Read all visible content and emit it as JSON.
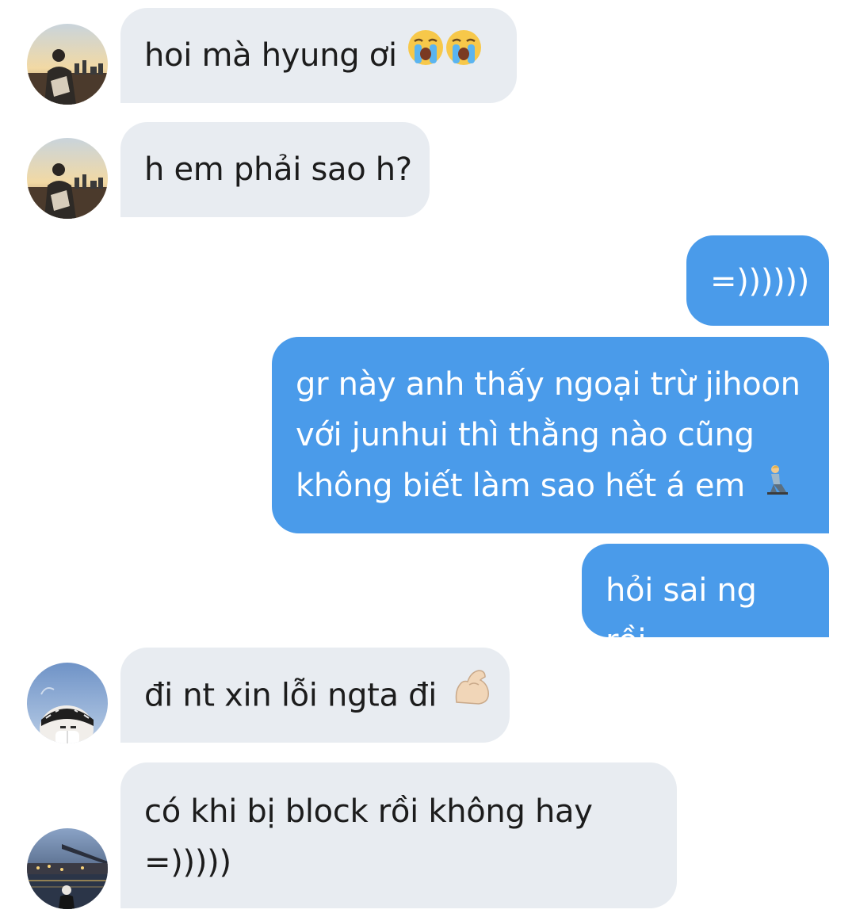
{
  "messages": [
    {
      "direction": "incoming",
      "sender_avatar": "avatar-skyline-man",
      "text": "hoi mà hyung ơi",
      "emoji": [
        "crying-face-icon",
        "crying-face-icon"
      ]
    },
    {
      "direction": "incoming",
      "sender_avatar": "avatar-skyline-man",
      "text": "h em phải sao h?"
    },
    {
      "direction": "outgoing",
      "text": "=))))))"
    },
    {
      "direction": "outgoing",
      "text": "gr này anh thấy ngoại trừ jihoon\nvới junhui thì thằng nào cũng\nkhông biết làm sao hết á em",
      "emoji": [
        "kneeling-person-icon"
      ]
    },
    {
      "direction": "outgoing",
      "text": "hỏi sai ng rồi"
    },
    {
      "direction": "incoming",
      "sender_avatar": "avatar-beanie-boy",
      "text": "đi nt xin lỗi ngta đi",
      "emoji": [
        "flexed-biceps-icon"
      ]
    },
    {
      "direction": "incoming",
      "sender_avatar": "avatar-night-bridge",
      "text": "có khi bị block rồi không hay\n=)))))"
    }
  ],
  "colors": {
    "incoming_bubble": "#e8ecf1",
    "outgoing_bubble": "#4a9bea",
    "incoming_text": "#1c1c1c",
    "outgoing_text": "#ffffff"
  }
}
